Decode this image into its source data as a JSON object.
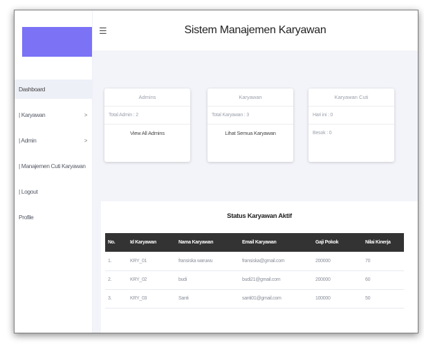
{
  "app": {
    "title": "Sistem Manajemen Karyawan"
  },
  "sidebar": {
    "items": [
      {
        "label": "Dashboard",
        "chevron": ""
      },
      {
        "label": "| Karyawan",
        "chevron": ">"
      },
      {
        "label": "| Admin",
        "chevron": ">"
      },
      {
        "label": "| Manajemen Cuti Karyawan",
        "chevron": ""
      },
      {
        "label": "| Logout",
        "chevron": ""
      },
      {
        "label": "Profile",
        "chevron": ""
      }
    ]
  },
  "cards": {
    "admins": {
      "title": "Admins",
      "total": "Total Admin : 2",
      "link": "View All Admins"
    },
    "karyawan": {
      "title": "Karyawan",
      "total": "Total Karyawan : 3",
      "link": "Lihat Semua Karyawan"
    },
    "cuti": {
      "title": "Karyawan Cuti",
      "today": "Hari ini : 0",
      "tomorrow": "Besok : 0"
    }
  },
  "status": {
    "title": "Status Karyawan Aktif",
    "headers": [
      "No.",
      "Id Karyawan",
      "Nama Karyawan",
      "Email Karyawan",
      "Gaji Pokok",
      "Nilai Kinerja"
    ],
    "rows": [
      [
        "1.",
        "KRY_01",
        "fransiska waruwu",
        "fransiska@gmail.com",
        "200000",
        "70"
      ],
      [
        "2.",
        "KRY_02",
        "budi",
        "budi21@gmail.com",
        "200000",
        "60"
      ],
      [
        "3.",
        "KRY_03",
        "Santi",
        "santi01@gmail.com",
        "100000",
        "50"
      ]
    ]
  },
  "colors": {
    "brand": "#7b72f6",
    "table_header": "#333333",
    "content_bg": "#f3f4f9"
  },
  "icons": {
    "menu": "hamburger-icon",
    "expand": "chevron-right-icon"
  }
}
